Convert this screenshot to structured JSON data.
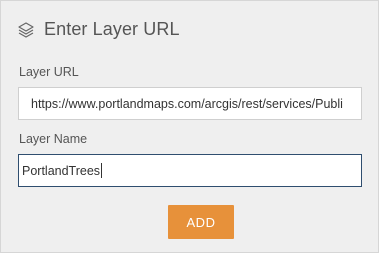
{
  "header": {
    "icon": "layers-icon",
    "title": "Enter Layer URL"
  },
  "layer_url": {
    "label": "Layer URL",
    "value": "https://www.portlandmaps.com/arcgis/rest/services/Publi"
  },
  "layer_name": {
    "label": "Layer Name",
    "value": "PortlandTrees"
  },
  "add_button": {
    "label": "ADD"
  },
  "colors": {
    "panel_bg": "#efefef",
    "accent_button": "#e7913a",
    "focus_border": "#2f4e6f"
  }
}
